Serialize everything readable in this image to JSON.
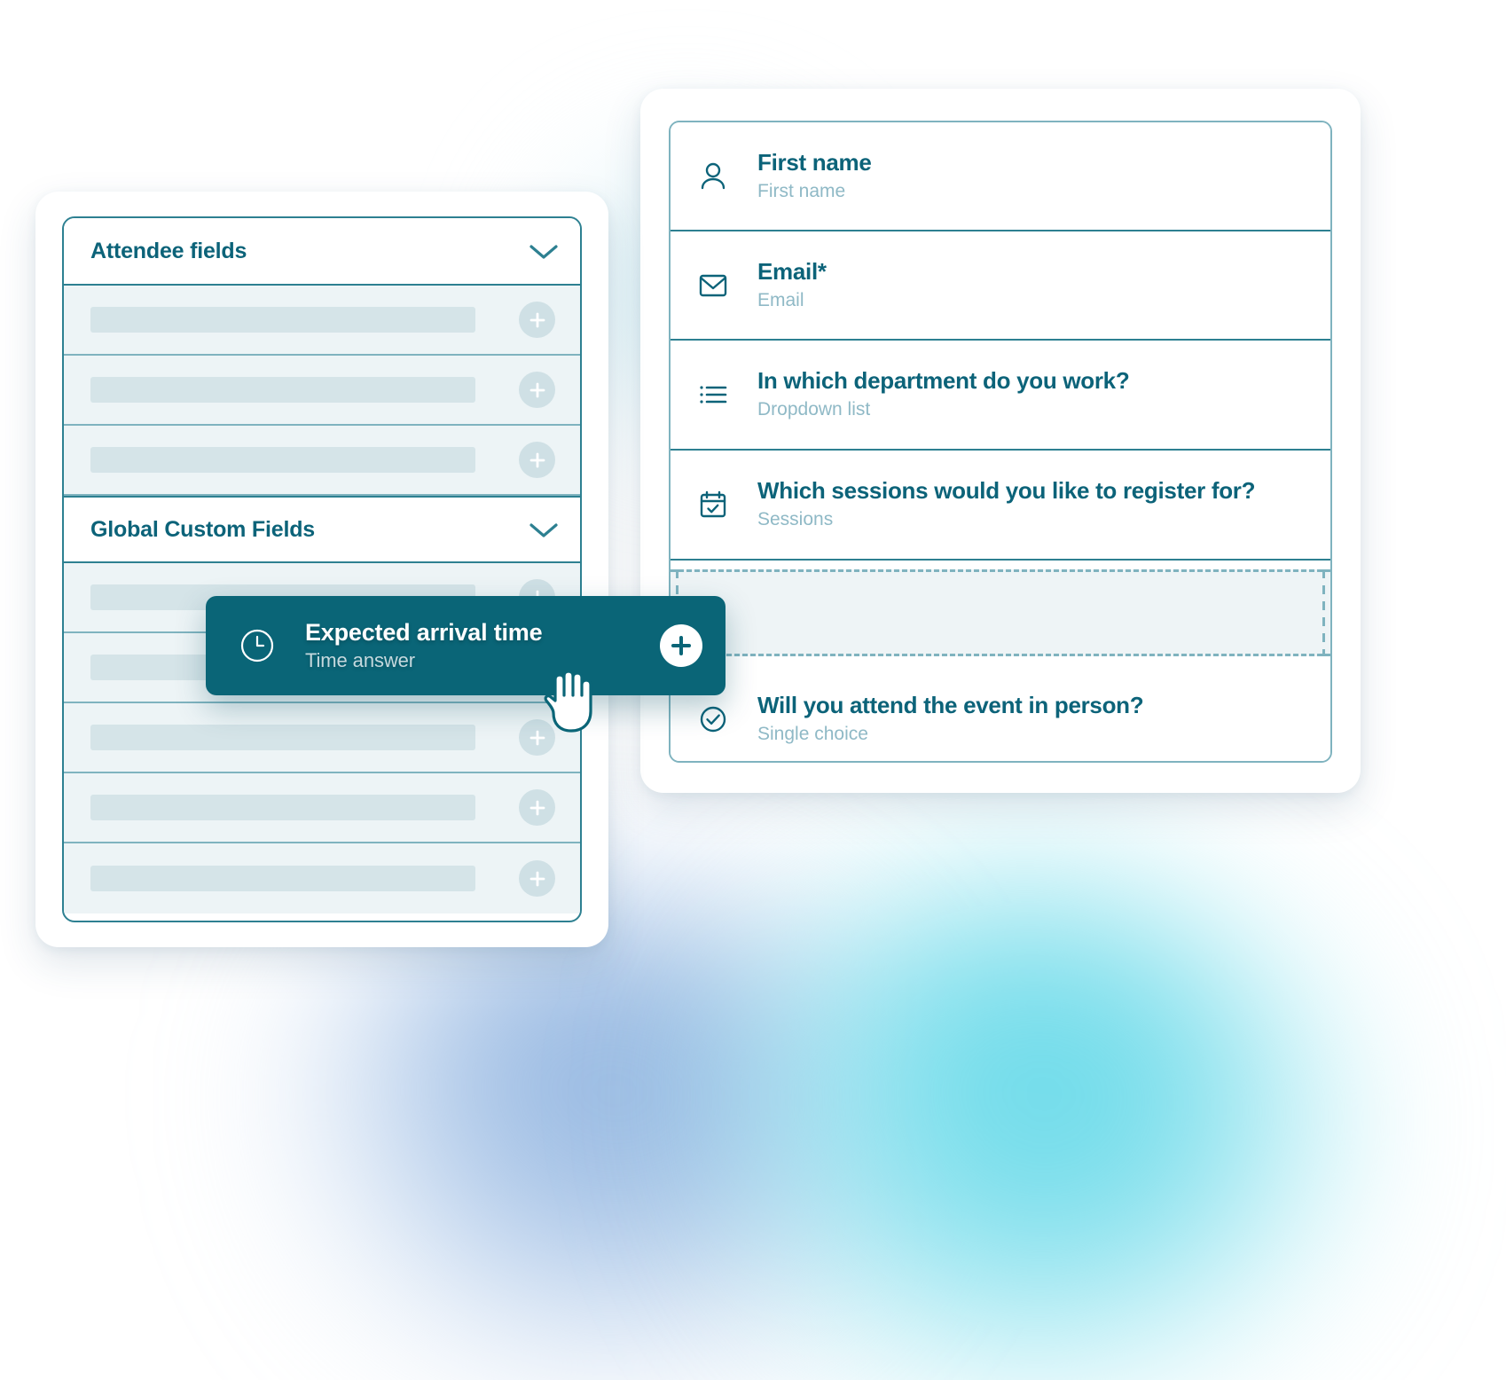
{
  "theme": {
    "accent_dark": "#0c6379",
    "accent_chip": "#0a6577",
    "border_teal": "#2d8091",
    "border_light": "#7fb3bf",
    "row_fill": "#edf4f6",
    "placeholder_bar": "#d5e4e8",
    "muted_text": "#8fb9c6",
    "glow_cyan": "#7fdfec",
    "glow_blue": "#a5c2e6"
  },
  "left_panel": {
    "sections": [
      {
        "title": "Attendee fields",
        "chevron_icon": "chevron-down-icon",
        "expanded": true,
        "rows": [
          {
            "add_icon": "plus-icon"
          },
          {
            "add_icon": "plus-icon"
          },
          {
            "add_icon": "plus-icon"
          }
        ]
      },
      {
        "title": "Global Custom Fields",
        "chevron_icon": "chevron-down-icon",
        "expanded": true,
        "rows": [
          {
            "add_icon": "plus-icon"
          },
          {
            "add_icon": "plus-icon"
          },
          {
            "add_icon": "plus-icon"
          },
          {
            "add_icon": "plus-icon"
          },
          {
            "add_icon": "plus-icon"
          }
        ]
      }
    ]
  },
  "right_panel": {
    "fields": [
      {
        "icon": "person-icon",
        "label": "First name",
        "type_label": "First name"
      },
      {
        "icon": "envelope-icon",
        "label": "Email*",
        "type_label": "Email"
      },
      {
        "icon": "list-icon",
        "label": "In which department do you work?",
        "type_label": "Dropdown list"
      },
      {
        "icon": "calendar-check-icon",
        "label": "Which sessions would you like to register for?",
        "type_label": "Sessions"
      },
      {
        "icon": "check-circle-icon",
        "label": "Will you attend the event in person?",
        "type_label": "Single choice"
      }
    ],
    "drop_zone": {
      "name": "drop-placeholder",
      "style": "dashed",
      "after_field_index": 3
    }
  },
  "drag_chip": {
    "icon": "clock-icon",
    "title": "Expected arrival time",
    "subtitle": "Time answer",
    "add_icon": "plus-circle-icon"
  },
  "cursor": {
    "icon": "grab-hand-cursor"
  }
}
